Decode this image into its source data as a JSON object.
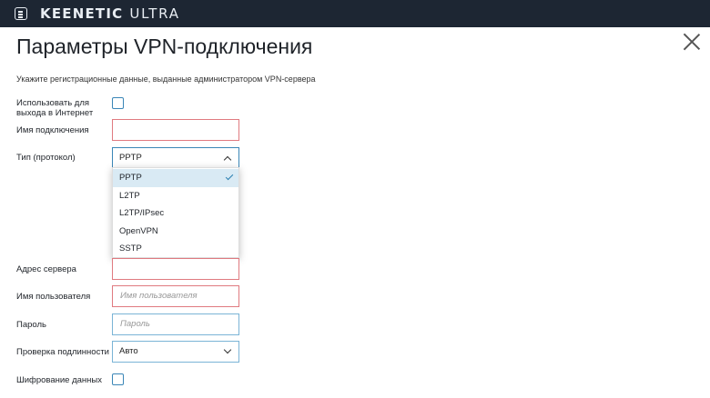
{
  "header": {
    "brand_bold": "KEENETIC",
    "brand_light": "ULTRA"
  },
  "page": {
    "title": "Параметры VPN-подключения",
    "hint": "Укажите регистрационные данные, выданные администратором VPN-сервера"
  },
  "form": {
    "use_for_internet": {
      "label_line1": "Использовать для",
      "label_line2": "выхода в Интернет",
      "checked": false
    },
    "connection_name": {
      "label": "Имя подключения",
      "value": ""
    },
    "protocol": {
      "label": "Тип (протокол)",
      "value": "PPTP",
      "options": [
        "PPTP",
        "L2TP",
        "L2TP/IPsec",
        "OpenVPN",
        "SSTP"
      ],
      "selected_option": "PPTP"
    },
    "server_address": {
      "label": "Адрес сервера",
      "value": ""
    },
    "username": {
      "label": "Имя пользователя",
      "placeholder": "Имя пользователя"
    },
    "password": {
      "label": "Пароль",
      "placeholder": "Пароль"
    },
    "auth_check": {
      "label": "Проверка подлинности",
      "value": "Авто"
    },
    "encryption": {
      "label": "Шифрование данных",
      "checked": false
    }
  },
  "colors": {
    "topbar": "#1d2633",
    "accent": "#3a86b7",
    "error_border": "#e07a80",
    "selected_option_bg": "#d9eaf4"
  },
  "icons": {
    "menu": "menu-icon",
    "close": "close-icon",
    "chevron_up": "chevron-up-icon",
    "chevron_down": "chevron-down-icon",
    "check": "check-icon"
  }
}
